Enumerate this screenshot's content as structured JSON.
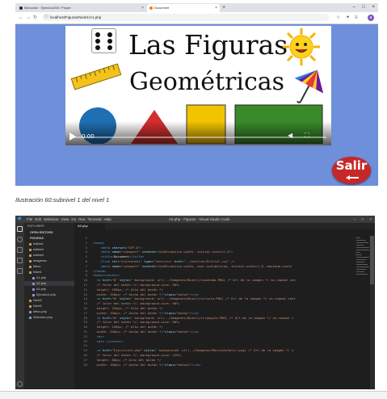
{
  "browser": {
    "tabs": [
      {
        "title": "Ejecución · Ejercicio208 / Pruyer",
        "icon_color": "#24292e"
      },
      {
        "title": "Document",
        "icon_color": "#ff7a00"
      }
    ],
    "new_tab_glyph": "+",
    "url": "localhost/Figuras/Nivel1/A1.php",
    "profile_initial": "a",
    "accent": "#7e57c2"
  },
  "page": {
    "title_line1": "Las Figuras",
    "title_line2": "Geométricas",
    "video": {
      "time": "0:00",
      "progress": 0
    },
    "salir_label": "Salir",
    "salir_color": "#c62828",
    "background": "#6e8fd9",
    "shapes": [
      {
        "name": "circle",
        "color": "#1f6fb2"
      },
      {
        "name": "triangle",
        "color": "#d32f2f"
      },
      {
        "name": "square",
        "color": "#f2c400"
      },
      {
        "name": "rectangle",
        "color": "#3a8a2a"
      }
    ]
  },
  "caption": "Ilustración 60:subnivel 1 del nivel 1",
  "vscode": {
    "menu": [
      "File",
      "Edit",
      "Selection",
      "View",
      "Go",
      "Run",
      "Terminal",
      "Help"
    ],
    "window_title": "A2.php - Figuras - Visual Studio Code",
    "explorer_title": "EXPLORER",
    "editor_tab": "A2.php",
    "explorer_rows": [
      {
        "label": "OPEN EDITORS",
        "indent": 1,
        "kind": "section"
      },
      {
        "label": "FIGURAS",
        "indent": 1,
        "kind": "section"
      },
      {
        "label": "estilos1",
        "indent": 3,
        "kind": "folder"
      },
      {
        "label": "estilos2",
        "indent": 3,
        "kind": "folder"
      },
      {
        "label": "estilos3",
        "indent": 3,
        "kind": "folder"
      },
      {
        "label": "Imagenes",
        "indent": 3,
        "kind": "folder"
      },
      {
        "label": "Menu",
        "indent": 3,
        "kind": "folder"
      },
      {
        "label": "Nivel1",
        "indent": 3,
        "kind": "folder"
      },
      {
        "label": "A1.php",
        "indent": 5,
        "kind": "php"
      },
      {
        "label": "A2.php",
        "indent": 5,
        "kind": "php",
        "selected": true
      },
      {
        "label": "A3.php",
        "indent": 5,
        "kind": "php"
      },
      {
        "label": "Ejercicio1.php",
        "indent": 5,
        "kind": "php"
      },
      {
        "label": "Nivel2",
        "indent": 3,
        "kind": "folder"
      },
      {
        "label": "Nivel3",
        "indent": 3,
        "kind": "folder"
      },
      {
        "label": "Menu.php",
        "indent": 3,
        "kind": "php"
      },
      {
        "label": "Seleccion.php",
        "indent": 3,
        "kind": "php"
      }
    ],
    "code_lines": [
      [
        {
          "t": "",
          "c": "txt"
        }
      ],
      [
        {
          "t": "<head>",
          "c": "tag"
        }
      ],
      [
        {
          "t": "    <meta ",
          "c": "tag"
        },
        {
          "t": "charset=",
          "c": "attr"
        },
        {
          "t": "\"UTF-8\"",
          "c": "str"
        },
        {
          "t": ">",
          "c": "tag"
        }
      ],
      [
        {
          "t": "    <meta ",
          "c": "tag"
        },
        {
          "t": "name=",
          "c": "attr"
        },
        {
          "t": "\"viewport\" ",
          "c": "str"
        },
        {
          "t": "content=",
          "c": "attr"
        },
        {
          "t": "\"width=device-width, initial-scale=1.0\"",
          "c": "str"
        },
        {
          "t": ">",
          "c": "tag"
        }
      ],
      [
        {
          "t": "    <title>",
          "c": "tag"
        },
        {
          "t": "Document",
          "c": "txt"
        },
        {
          "t": "</title>",
          "c": "tag"
        }
      ],
      [
        {
          "t": "    <link ",
          "c": "tag"
        },
        {
          "t": "rel=",
          "c": "attr"
        },
        {
          "t": "\"stylesheet\" ",
          "c": "str"
        },
        {
          "t": "type=",
          "c": "attr"
        },
        {
          "t": "\"text/css\" ",
          "c": "str"
        },
        {
          "t": "href=",
          "c": "attr"
        },
        {
          "t": "\"../estilos/Estilo1.css\"",
          "c": "str"
        },
        {
          "t": " />",
          "c": "tag"
        }
      ],
      [
        {
          "t": "    <meta ",
          "c": "tag"
        },
        {
          "t": "name=",
          "c": "attr"
        },
        {
          "t": "\"viewport\" ",
          "c": "str"
        },
        {
          "t": "content=",
          "c": "attr"
        },
        {
          "t": "\"width=device-width, user-scalable=no, initial-scale=1.0, maximum-scale",
          "c": "str"
        }
      ],
      [
        {
          "t": "</head>",
          "c": "tag"
        }
      ],
      [
        {
          "t": "<body><center>",
          "c": "tag"
        }
      ],
      [
        {
          "t": "  <a ",
          "c": "tag"
        },
        {
          "t": "href=",
          "c": "attr"
        },
        {
          "t": "\"#\" ",
          "c": "str"
        },
        {
          "t": "style=",
          "c": "attr"
        },
        {
          "t": "\" background: url(../Imagenes/Nivel1/cuadrado.PNG) /* Url de la imagen */ no-repeat cen",
          "c": "str"
        }
      ],
      [
        {
          "t": "  /* Color del botón */; background-size: 98%;",
          "c": "str"
        }
      ],
      [
        {
          "t": "  height: 250px; /* Alto del botón */",
          "c": "str"
        }
      ],
      [
        {
          "t": "  width: 250px; /* Ancho del botón */\"",
          "c": "str"
        },
        {
          "t": "class=",
          "c": "attr"
        },
        {
          "t": "\"boton\"",
          "c": "str"
        },
        {
          "t": "></a>",
          "c": "tag"
        }
      ],
      [
        {
          "t": "  <a ",
          "c": "tag"
        },
        {
          "t": "href=",
          "c": "attr"
        },
        {
          "t": "\"#\" ",
          "c": "str"
        },
        {
          "t": "style=",
          "c": "attr"
        },
        {
          "t": "\" background: url(../Imagenes/Nivel1/circulo.PNG) /* Url de la imagen */ no-repeat cent",
          "c": "str"
        }
      ],
      [
        {
          "t": "  /* Color del botón */; background-size: 98%;",
          "c": "str"
        }
      ],
      [
        {
          "t": "  height: 250px; /* Alto del botón */",
          "c": "str"
        }
      ],
      [
        {
          "t": "  width: 250px; /* Ancho del botón */\"",
          "c": "str"
        },
        {
          "t": "class=",
          "c": "attr"
        },
        {
          "t": "\"boton\"",
          "c": "str"
        },
        {
          "t": "></a>",
          "c": "tag"
        }
      ],
      [
        {
          "t": "  <a ",
          "c": "tag"
        },
        {
          "t": "href=",
          "c": "attr"
        },
        {
          "t": "\"#\" ",
          "c": "str"
        },
        {
          "t": "style=",
          "c": "attr"
        },
        {
          "t": "\" background: url(../Imagenes/Nivel1/triangulo.PNG) /* Url de la imagen */ no-repeat c",
          "c": "str"
        }
      ],
      [
        {
          "t": "  /* Color del botón */; background-size: 98%;",
          "c": "str"
        }
      ],
      [
        {
          "t": "  height: 250px; /* Alto del botón */",
          "c": "str"
        }
      ],
      [
        {
          "t": "  width: 250px; /* Ancho del botón */\"",
          "c": "str"
        },
        {
          "t": "class=",
          "c": "attr"
        },
        {
          "t": "\"boton\"",
          "c": "str"
        },
        {
          "t": "></a>",
          "c": "tag"
        }
      ],
      [
        {
          "t": "  <br>",
          "c": "tag"
        }
      ],
      [
        {
          "t": "  <div ",
          "c": "tag"
        },
        {
          "t": "</center>",
          "c": "tag"
        }
      ],
      [
        {
          "t": "",
          "c": "txt"
        }
      ],
      [
        {
          "t": "  <a ",
          "c": "tag"
        },
        {
          "t": "href=",
          "c": "attr"
        },
        {
          "t": "\"Ejercicio1.php\" ",
          "c": "str"
        },
        {
          "t": "style=",
          "c": "attr"
        },
        {
          "t": "\" background: url(../Imagenes/Menu/btnSalir.png) /* Url de la imagen */ n",
          "c": "str"
        }
      ],
      [
        {
          "t": "  /* Color del botón */; background-size: 125%;",
          "c": "str"
        }
      ],
      [
        {
          "t": "  height: 80px; /* Alto del botón */",
          "c": "str"
        }
      ],
      [
        {
          "t": "  width: 100px; /* Ancho del botón */\"",
          "c": "str"
        },
        {
          "t": "class=",
          "c": "attr"
        },
        {
          "t": "\"boton1\"",
          "c": "str"
        },
        {
          "t": "></a>",
          "c": "tag"
        }
      ]
    ]
  }
}
